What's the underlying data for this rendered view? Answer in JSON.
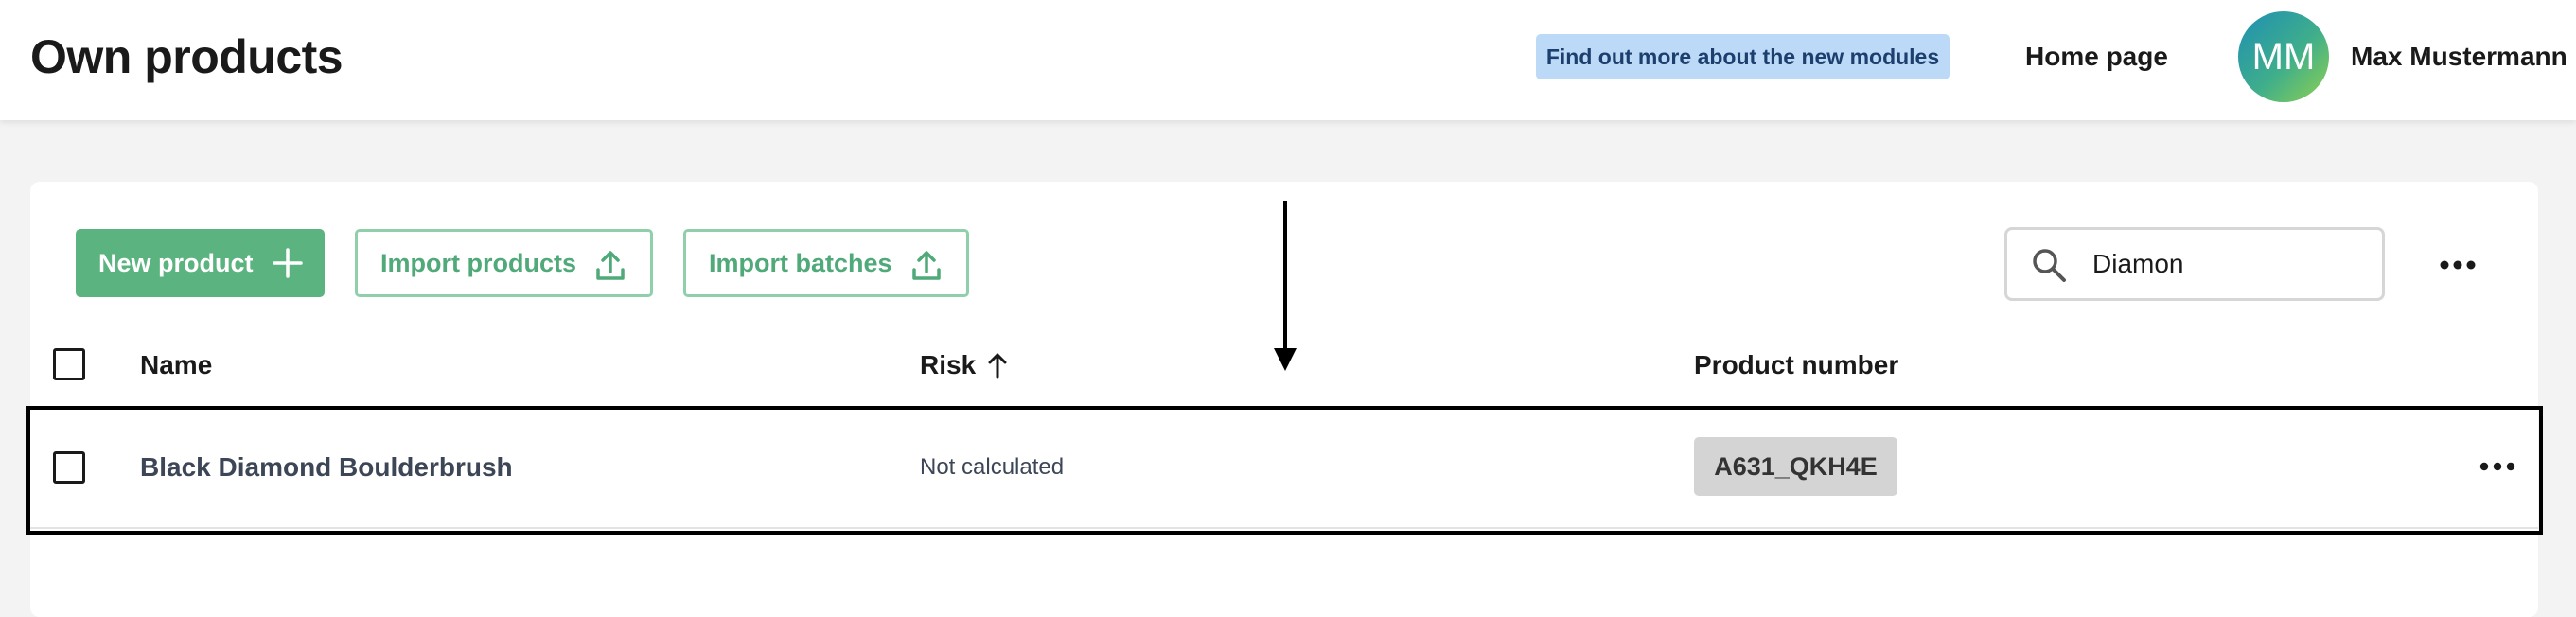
{
  "header": {
    "title": "Own products",
    "modules_banner": "Find out more about the new modules",
    "home_link": "Home page",
    "user": {
      "initials": "MM",
      "name": "Max Mustermann"
    }
  },
  "toolbar": {
    "new_product": "New product",
    "import_products": "Import products",
    "import_batches": "Import batches",
    "search": {
      "value": "Diamon",
      "icon": "search-icon"
    },
    "more_icon": "more-horizontal-icon"
  },
  "table": {
    "columns": {
      "name": "Name",
      "risk": "Risk",
      "product_number": "Product number"
    },
    "sort": {
      "column": "risk",
      "direction": "ascending"
    },
    "rows": [
      {
        "name": "Black Diamond Boulderbrush",
        "risk": "Not calculated",
        "product_number": "A631_QKH4E",
        "selected": false
      }
    ]
  },
  "colors": {
    "primary": "#5bb37f",
    "primary_border": "#8fd0ab",
    "banner_bg": "#bcd9f7",
    "banner_text": "#1d3f6e",
    "chip_bg": "#d4d4d4"
  }
}
